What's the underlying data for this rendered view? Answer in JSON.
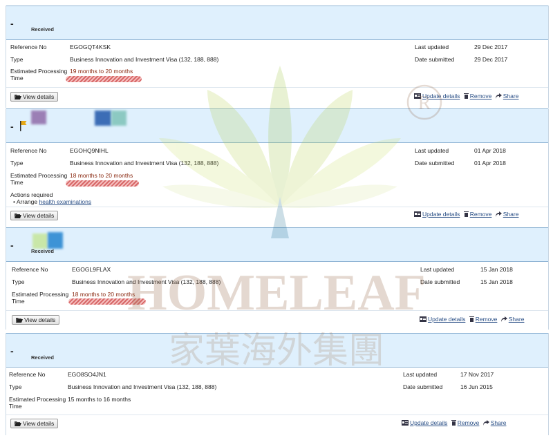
{
  "cards": [
    {
      "status": "Received",
      "reference_label": "Reference No",
      "reference": "EGOGQT4KSK",
      "type_label": "Type",
      "type": "Business Innovation and Investment Visa (132, 188, 888)",
      "processing_label": "Estimated Processing Time",
      "processing": "19 months to 20 months",
      "last_updated_label": "Last updated",
      "last_updated": "29 Dec 2017",
      "date_submitted_label": "Date submitted",
      "date_submitted": "29 Dec 2017",
      "view_details": "View details",
      "update_details": "Update details",
      "remove": "Remove",
      "share": "Share"
    },
    {
      "status": "",
      "reference_label": "Reference No",
      "reference": "EGOHQ9NIHL",
      "type_label": "Type",
      "type": "Business Innovation and Investment Visa (132, 188, 888)",
      "processing_label": "Estimated Processing Time",
      "processing": "18 months to 20 months",
      "last_updated_label": "Last updated",
      "last_updated": "01 Apr 2018",
      "date_submitted_label": "Date submitted",
      "date_submitted": "01 Apr 2018",
      "actions_required_label": "Actions required",
      "action_prefix": "Arrange",
      "action_link": "health examinations",
      "view_details": "View details",
      "update_details": "Update details",
      "remove": "Remove",
      "share": "Share"
    },
    {
      "status": "Received",
      "reference_label": "Reference No",
      "reference": "EGOGL9FLAX",
      "type_label": "Type",
      "type": "Business Innovation and Investment Visa (132, 188, 888)",
      "processing_label": "Estimated Processing Time",
      "processing": "18 months to 20 months",
      "last_updated_label": "Last updated",
      "last_updated": "15 Jan 2018",
      "date_submitted_label": "Date submitted",
      "date_submitted": "15 Jan 2018",
      "view_details": "View details",
      "update_details": "Update details",
      "remove": "Remove",
      "share": "Share"
    },
    {
      "status": "Received",
      "reference_label": "Reference No",
      "reference": "EGO8SO4JN1",
      "type_label": "Type",
      "type": "Business Innovation and Investment Visa (132, 188, 888)",
      "processing_label": "Estimated Processing Time",
      "processing": "15 months to 16 months",
      "last_updated_label": "Last updated",
      "last_updated": "17 Nov 2017",
      "date_submitted_label": "Date submitted",
      "date_submitted": "16 Jun 2015",
      "view_details": "View details",
      "update_details": "Update details",
      "remove": "Remove",
      "share": "Share"
    }
  ],
  "watermark": {
    "brand_en": "HOMELEAF",
    "brand_zh": "家葉海外集團",
    "registered": "R"
  },
  "icons": {
    "view": "folder-open-icon",
    "update": "id-card-icon",
    "remove": "trash-icon",
    "share": "share-arrow-icon",
    "flag": "flag-icon"
  },
  "colors": {
    "header_bg": "#dff0fd",
    "link": "#2a4f86",
    "processing_text": "#8a2a12"
  }
}
